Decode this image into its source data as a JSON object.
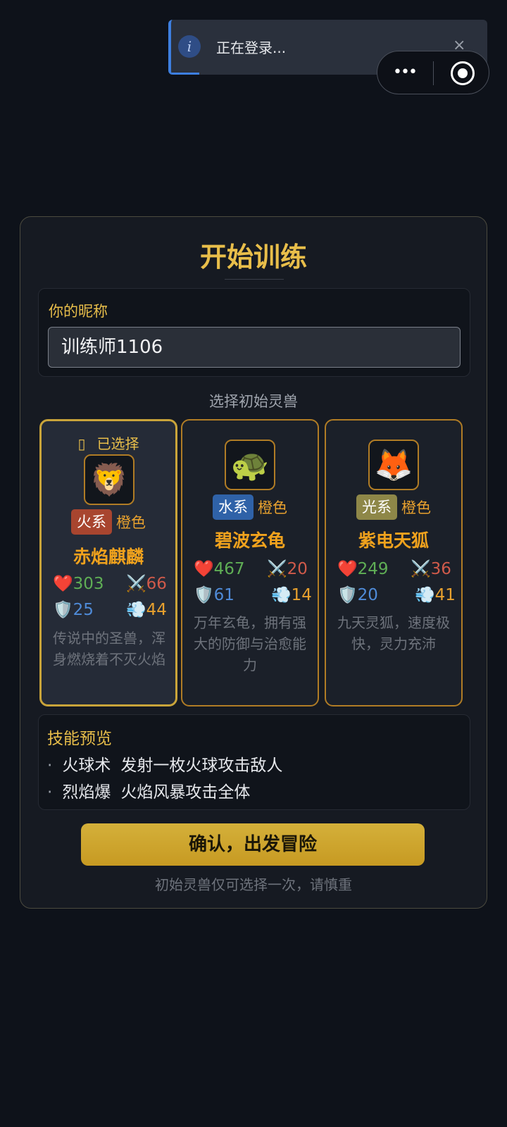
{
  "toast": {
    "message": "正在登录...",
    "close_icon": "×",
    "info_icon": "i"
  },
  "capsule": {
    "more_icon": "•••",
    "close_icon": "target"
  },
  "card": {
    "title": "开始训练",
    "nickname_label": "你的昵称",
    "nickname_value": "训练师1106",
    "choose_label": "选择初始灵兽",
    "beasts": [
      {
        "selected_mark": "已选择",
        "emoji": "🦁",
        "element": "火系",
        "element_color": "#a8452f",
        "quality": "橙色",
        "name": "赤焰麒麟",
        "hp": "303",
        "atk": "66",
        "def": "25",
        "spd": "44",
        "desc": "传说中的圣兽，浑身燃烧着不灭火焰"
      },
      {
        "emoji": "🐢",
        "element": "水系",
        "element_color": "#2f62a8",
        "quality": "橙色",
        "name": "碧波玄龟",
        "hp": "467",
        "atk": "20",
        "def": "61",
        "spd": "14",
        "desc": "万年玄龟，拥有强大的防御与治愈能力"
      },
      {
        "emoji": "🦊",
        "element": "光系",
        "element_color": "#8e8748",
        "quality": "橙色",
        "name": "紫电天狐",
        "hp": "249",
        "atk": "36",
        "def": "20",
        "spd": "41",
        "desc": "九天灵狐，速度极快，灵力充沛"
      }
    ],
    "stat_icons": {
      "hp": "❤️",
      "atk": "⚔️",
      "def": "🛡️",
      "spd": "💨"
    },
    "skills_title": "技能预览",
    "skills": [
      {
        "bullet": "·",
        "name": "火球术",
        "desc": "发射一枚火球攻击敌人"
      },
      {
        "bullet": "·",
        "name": "烈焰爆",
        "desc": "火焰风暴攻击全体"
      }
    ],
    "confirm_label": "确认，出发冒险",
    "note": "初始灵兽仅可选择一次，请慎重"
  }
}
